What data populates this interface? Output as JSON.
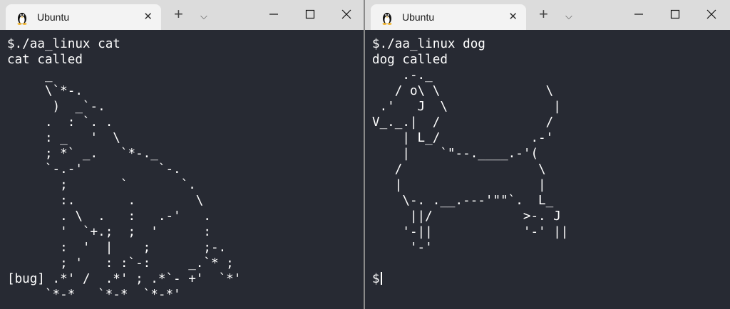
{
  "windows": [
    {
      "tab": {
        "title": "Ubuntu",
        "icon": "tux-icon",
        "close_glyph": "✕"
      },
      "toolbar": {
        "new_tab_glyph": "+",
        "dropdown_glyph": "⌵"
      },
      "controls": {
        "minimize": "minimize-icon",
        "maximize": "maximize-icon",
        "close": "close-icon"
      },
      "terminal": {
        "lines": [
          "$./aa_linux cat",
          "cat called",
          "     _",
          "     \\`*-.",
          "      )  _`-.",
          "     .  : `. .",
          "     : _   '  \\",
          "     ; *` _.   `*-._",
          "     `-.-'          `-.",
          "       ;       `       `.",
          "       :.       .        \\",
          "       . \\  .   :   .-'   .",
          "       '  `+.;  ;  '      :",
          "       :  '  |    ;       ;-.",
          "       ; '   : :`-:     _.`* ;",
          "[bug] .*' /  .*' ; .*`- +'  `*'",
          "     `*-*   `*-*  `*-*'"
        ]
      }
    },
    {
      "tab": {
        "title": "Ubuntu",
        "icon": "tux-icon",
        "close_glyph": "✕"
      },
      "toolbar": {
        "new_tab_glyph": "+",
        "dropdown_glyph": "⌵"
      },
      "controls": {
        "minimize": "minimize-icon",
        "maximize": "maximize-icon",
        "close": "close-icon"
      },
      "terminal": {
        "lines": [
          "$./aa_linux dog",
          "dog called",
          "    .-._",
          "   / o\\ \\              \\",
          " .'   J  \\              |",
          "V_._.|  /              /",
          "    | L_/            .-'",
          "    |    `\"--.____.-'(",
          "   /                  \\",
          "   |                  |",
          "    \\-. .__.---'\"\"`.  L_",
          "     ||/            >-. J",
          "    '-||            '-' ||",
          "     '-'",
          ""
        ],
        "prompt": "$"
      }
    }
  ],
  "colors": {
    "terminal_bg": "#272a33",
    "titlebar_bg": "#dcdcdc",
    "tab_bg": "#f3f3f3",
    "text": "#ffffff"
  }
}
